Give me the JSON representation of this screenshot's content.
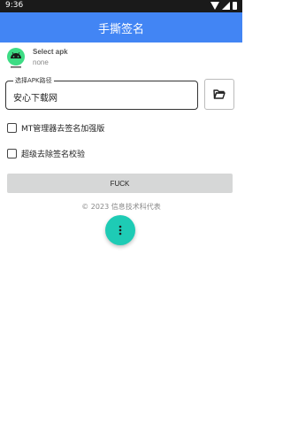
{
  "status_bar": {
    "time": "9:36",
    "icons": [
      "wifi-icon",
      "signal-icon",
      "battery-icon"
    ]
  },
  "app_bar": {
    "title": "手撕签名",
    "color": "#4285f4"
  },
  "apk": {
    "title": "Select apk",
    "subtitle": "none",
    "icon": "android-icon"
  },
  "path_field": {
    "label": "选择APK路径",
    "value": "安心下载网"
  },
  "folder_button": {
    "icon": "folder-open-icon"
  },
  "options": [
    {
      "label": "MT管理器去签名加强版",
      "checked": false
    },
    {
      "label": "超级去除签名校验",
      "checked": false
    }
  ],
  "action_button": {
    "label": "FUCK"
  },
  "footer": {
    "text": "© 2023 信息技术科代表"
  },
  "fab": {
    "icon": "more-vert-icon",
    "color": "#1ecbb5"
  }
}
